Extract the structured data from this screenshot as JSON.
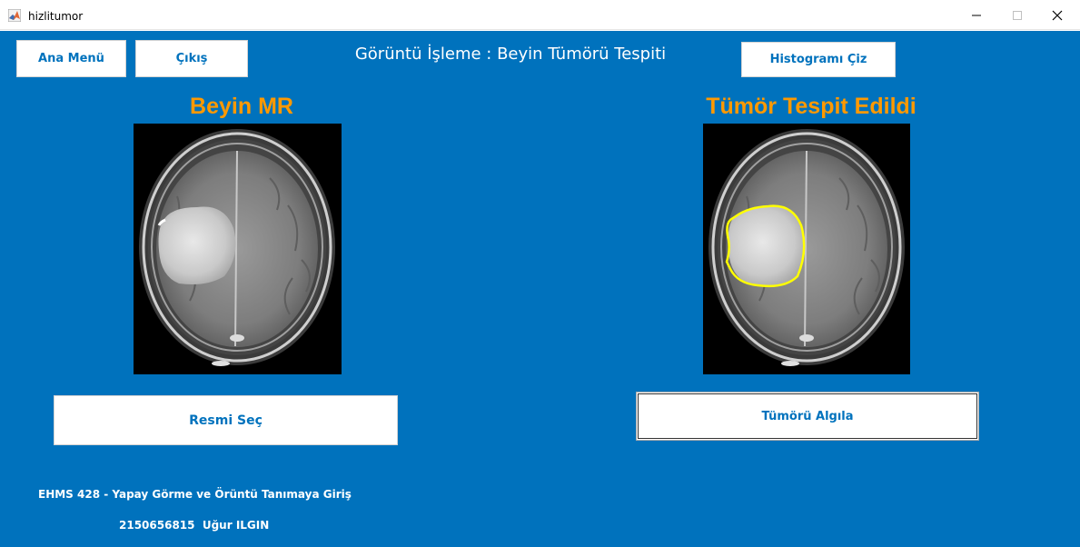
{
  "window": {
    "title": "hizlitumor",
    "icon": "matlab-icon",
    "controls": [
      "minimize-icon",
      "maximize-icon",
      "close-icon"
    ]
  },
  "header": {
    "title": "Görüntü İşleme : Beyin Tümörü Tespiti"
  },
  "buttons": {
    "ana_menu": "Ana Menü",
    "cikis": "Çıkış",
    "histogram": "Histogramı Çiz",
    "resmi_sec": "Resmi Seç",
    "tumoru_algila": "Tümörü Algıla"
  },
  "panels": {
    "left_title": "Beyin MR",
    "right_title": "Tümör Tespit Edildi"
  },
  "footer": {
    "course": "EHMS 428 - Yapay Görme ve Örüntü Tanımaya Giriş",
    "student": "2150656815  Uğur ILGIN"
  },
  "colors": {
    "background": "#0072bd",
    "title_accent": "#ff9900",
    "button_text": "#0072bd",
    "tumor_outline": "#ffff00"
  }
}
